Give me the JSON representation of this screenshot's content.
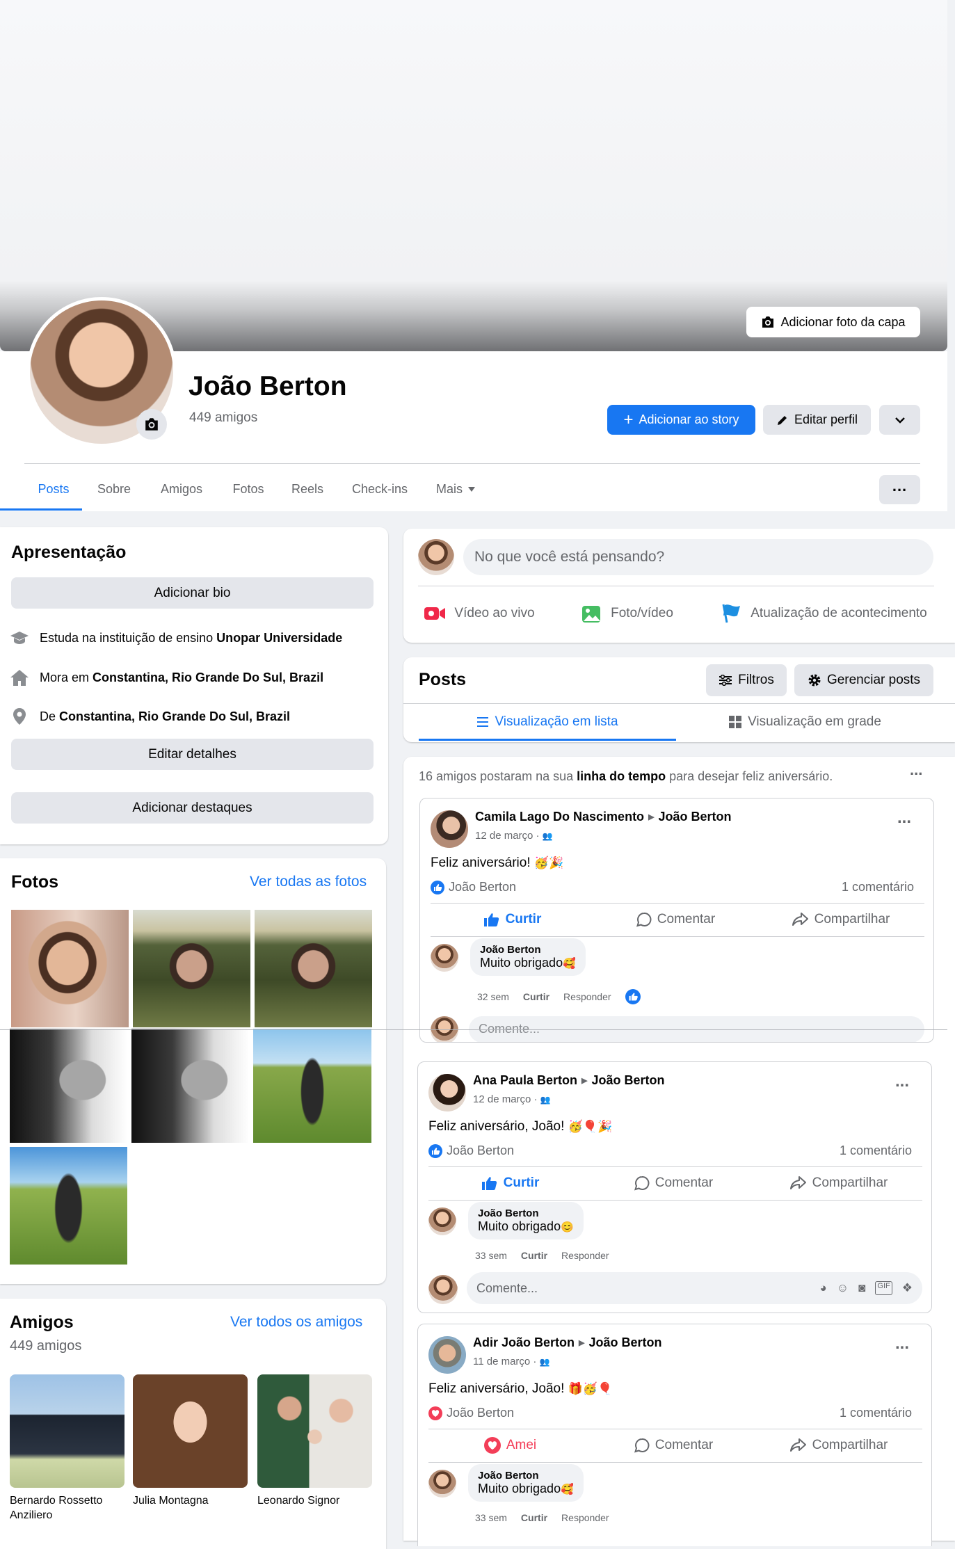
{
  "cover": {
    "add_cover_label": "Adicionar foto da capa"
  },
  "profile": {
    "name": "João Berton",
    "friends_count": "449 amigos"
  },
  "actions": {
    "add_story": "Adicionar ao story",
    "edit_profile": "Editar perfil"
  },
  "tabs": [
    "Posts",
    "Sobre",
    "Amigos",
    "Fotos",
    "Reels",
    "Check-ins",
    "Mais"
  ],
  "intro": {
    "title": "Apresentação",
    "add_bio": "Adicionar bio",
    "study_prefix": "Estuda na instituição de ensino ",
    "study_place": "Unopar Universidade",
    "lives_prefix": "Mora em ",
    "lives_place": "Constantina, Rio Grande Do Sul, Brazil",
    "from_prefix": "De ",
    "from_place": "Constantina, Rio Grande Do Sul, Brazil",
    "edit_details": "Editar detalhes",
    "add_highlights": "Adicionar destaques"
  },
  "photos": {
    "title": "Fotos",
    "see_all": "Ver todas as fotos"
  },
  "friends": {
    "title": "Amigos",
    "see_all": "Ver todos os amigos",
    "count": "449 amigos",
    "list": [
      {
        "name": "Bernardo Rossetto Anziliero"
      },
      {
        "name": "Julia Montagna"
      },
      {
        "name": "Leonardo Signor"
      }
    ]
  },
  "composer": {
    "placeholder": "No que você está pensando?",
    "live": "Vídeo ao vivo",
    "photo": "Foto/vídeo",
    "life_event": "Atualização de acontecimento"
  },
  "posts_header": {
    "title": "Posts",
    "filters": "Filtros",
    "manage": "Gerenciar posts",
    "list_view": "Visualização em lista",
    "grid_view": "Visualização em grade"
  },
  "birthday_summary": {
    "prefix": "16 amigos postaram na sua ",
    "bold": "linha do tempo",
    "suffix": " para desejar feliz aniversário."
  },
  "posts": [
    {
      "author": "Camila Lago Do Nascimento",
      "target": "João Berton",
      "date": "12 de março ·",
      "text": "Feliz aniversário!",
      "emoji": "🥳🎉",
      "reactor": "João Berton",
      "comments": "1 comentário",
      "like_label": "Curtir",
      "comment_label": "Comentar",
      "share_label": "Compartilhar",
      "reply_author": "João Berton",
      "reply_text": "Muito obrigado",
      "reply_emoji": "🥰",
      "reply_time": "32 sem",
      "reply_like": "Curtir",
      "reply_reply": "Responder",
      "comment_placeholder": "Comente..."
    },
    {
      "author": "Ana Paula Berton",
      "target": "João Berton",
      "date": "12 de março ·",
      "text": "Feliz aniversário, João!",
      "emoji": "🥳🎈🎉",
      "reactor": "João Berton",
      "comments": "1 comentário",
      "like_label": "Curtir",
      "comment_label": "Comentar",
      "share_label": "Compartilhar",
      "reply_author": "João Berton",
      "reply_text": "Muito obrigado",
      "reply_emoji": "😊",
      "reply_time": "33 sem",
      "reply_like": "Curtir",
      "reply_reply": "Responder",
      "comment_placeholder": "Comente..."
    },
    {
      "author": "Adir João Berton",
      "target": "João Berton",
      "date": "11 de março ·",
      "text": "Feliz aniversário, João!",
      "emoji": "🎁🥳🎈",
      "reactor": "João Berton",
      "comments": "1 comentário",
      "like_label": "Amei",
      "comment_label": "Comentar",
      "share_label": "Compartilhar",
      "reply_author": "João Berton",
      "reply_text": "Muito obrigado",
      "reply_emoji": "🥰",
      "reply_time": "33 sem",
      "reply_like": "Curtir",
      "reply_reply": "Responder"
    }
  ],
  "colors": {
    "accent": "#1877f2",
    "love": "#f33e58",
    "live": "#f02849",
    "photo": "#45bd62"
  }
}
